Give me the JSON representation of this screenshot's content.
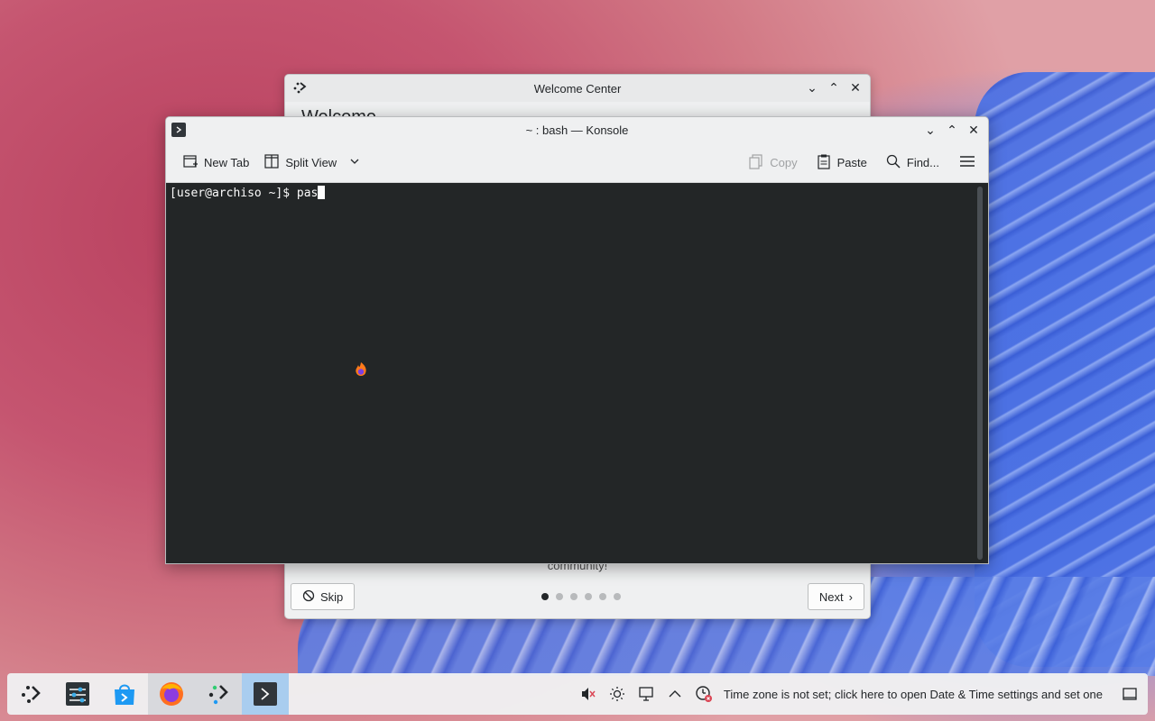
{
  "welcome_window": {
    "title": "Welcome Center",
    "heading_partial": "Welcome",
    "body_partial": "community!",
    "skip_label": "Skip",
    "next_label": "Next",
    "page_count": 6,
    "current_page": 1
  },
  "konsole": {
    "title": "~ : bash — Konsole",
    "toolbar": {
      "new_tab": "New Tab",
      "split_view": "Split View",
      "copy": "Copy",
      "paste": "Paste",
      "find": "Find..."
    },
    "prompt": "[user@archiso ~]$ ",
    "typed": "pas"
  },
  "panel": {
    "tasks": [
      "application-launcher-icon",
      "system-settings-icon",
      "discover-icon",
      "firefox-icon",
      "welcome-center-icon",
      "konsole-icon"
    ],
    "tray_message": "Time zone is not set; click here to open Date & Time settings and set one"
  },
  "colors": {
    "terminal_bg": "#232627",
    "active_task": "#a9cdef",
    "accent_blue": "#3daee9"
  }
}
